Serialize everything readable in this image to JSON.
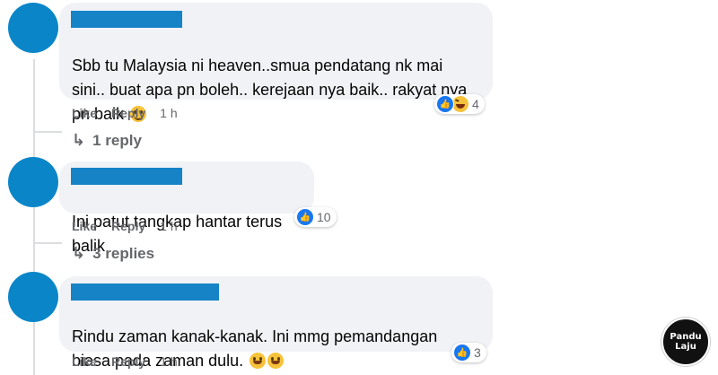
{
  "comments": [
    {
      "text": "Sbb tu Malaysia ni heaven..smua pendatang nk mai\nsini.. buat apa pn boleh.. kerejaan nya baik.. rakyat nya\npn baik",
      "emoji": "smile-emoji",
      "reaction_count": "4",
      "reactions": [
        "like-icon",
        "haha-icon"
      ],
      "like_label": "Like",
      "reply_label": "Reply",
      "time": "1 h",
      "replies_label": "1 reply"
    },
    {
      "text": "Ini patut tangkap hantar terus balik",
      "reaction_count": "10",
      "reactions": [
        "like-icon"
      ],
      "like_label": "Like",
      "reply_label": "Reply",
      "time": "1 h",
      "replies_label": "3 replies"
    },
    {
      "text": "Rindu zaman kanak-kanak. Ini mmg pemandangan\nbiasa pada zaman dulu.",
      "emoji": "grin-emoji",
      "reaction_count": "3",
      "reactions": [
        "like-icon"
      ],
      "like_label": "Like",
      "reply_label": "Reply",
      "time": "1 h"
    }
  ],
  "watermark": {
    "line1": "Pandu",
    "line2": "Laju"
  },
  "colors": {
    "avatar": "#0a86c8",
    "name_redaction": "#1683c6",
    "bubble": "#f0f2f5",
    "like_blue": "#1877f2",
    "meta_grey": "#65676b"
  }
}
